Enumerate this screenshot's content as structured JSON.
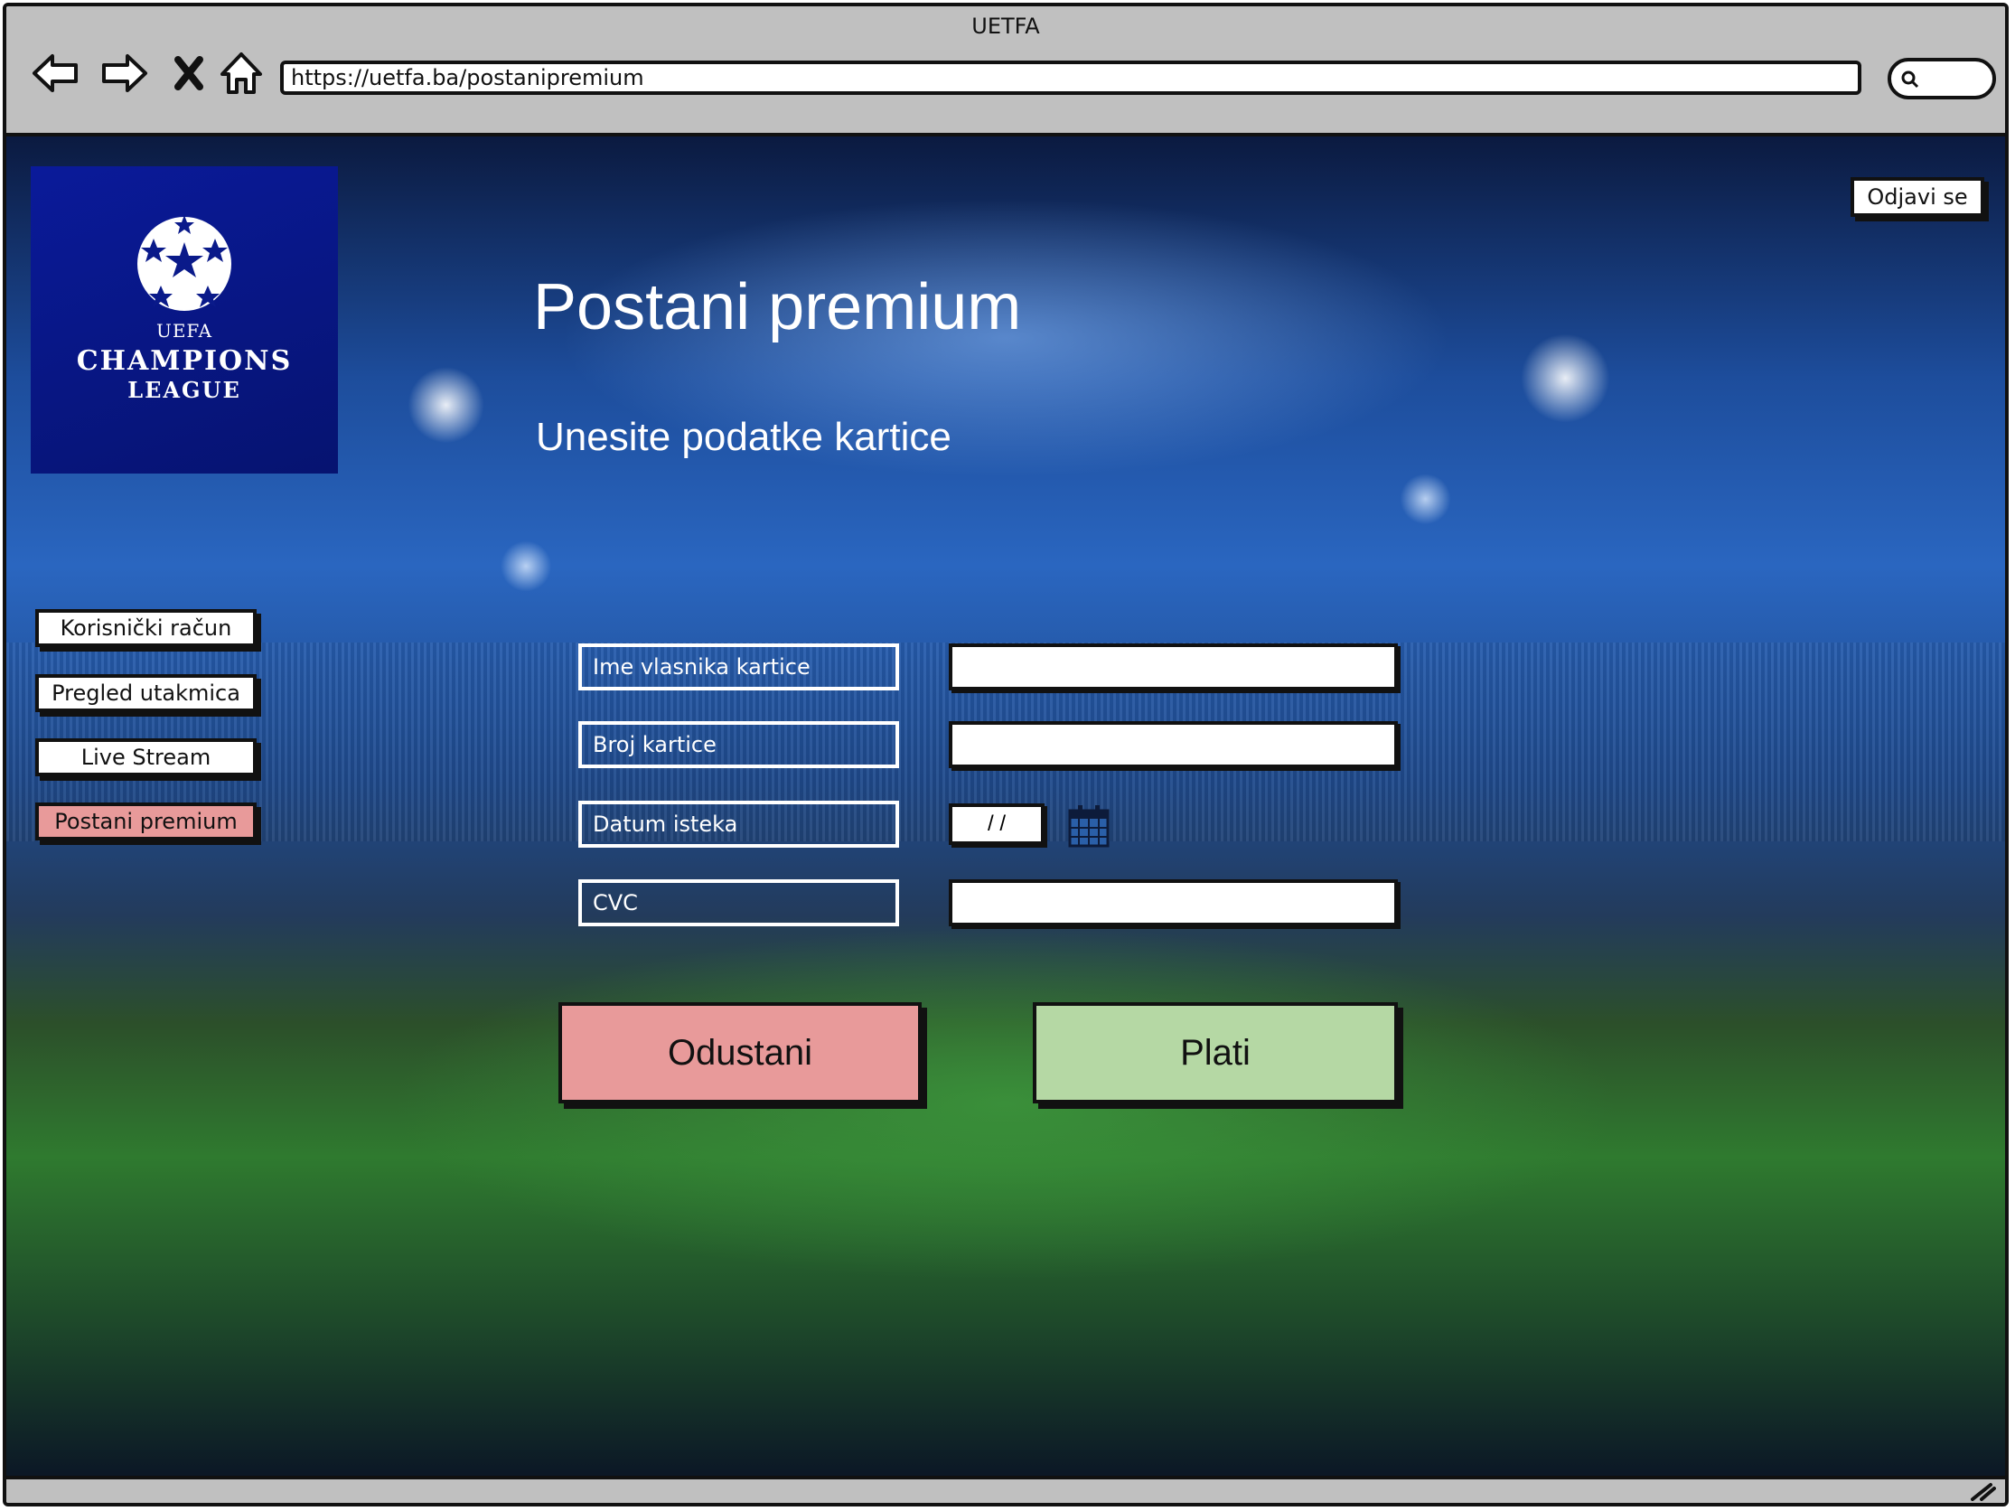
{
  "window": {
    "title": "UETFA"
  },
  "browser": {
    "url": "https://uetfa.ba/postanipremium",
    "nav_icons": [
      "back-icon",
      "forward-icon",
      "close-icon",
      "home-icon"
    ],
    "search_icon": "search-icon"
  },
  "header": {
    "logout_label": "Odjavi se"
  },
  "logo": {
    "line_uefa": "UEFA",
    "line_champions": "CHAMPIONS",
    "line_league": "LEAGUE"
  },
  "sidebar": {
    "items": [
      {
        "label": "Korisnički račun",
        "active": false
      },
      {
        "label": "Pregled utakmica",
        "active": false
      },
      {
        "label": "Live Stream",
        "active": false
      },
      {
        "label": "Postani premium",
        "active": true
      }
    ]
  },
  "main": {
    "title": "Postani premium",
    "subtitle": "Unesite podatke kartice",
    "fields": {
      "cardholder": {
        "label": "Ime vlasnika kartice",
        "value": ""
      },
      "card_number": {
        "label": "Broj kartice",
        "value": ""
      },
      "expiry": {
        "label": "Datum isteka",
        "value": "/ /"
      },
      "cvc": {
        "label": "CVC",
        "value": ""
      }
    },
    "cancel_label": "Odustani",
    "pay_label": "Plati"
  },
  "colors": {
    "active_nav": "#e89a9a",
    "cancel_button": "#e89a9a",
    "pay_button": "#b5d8a4",
    "chrome": "#c0c0c0"
  }
}
